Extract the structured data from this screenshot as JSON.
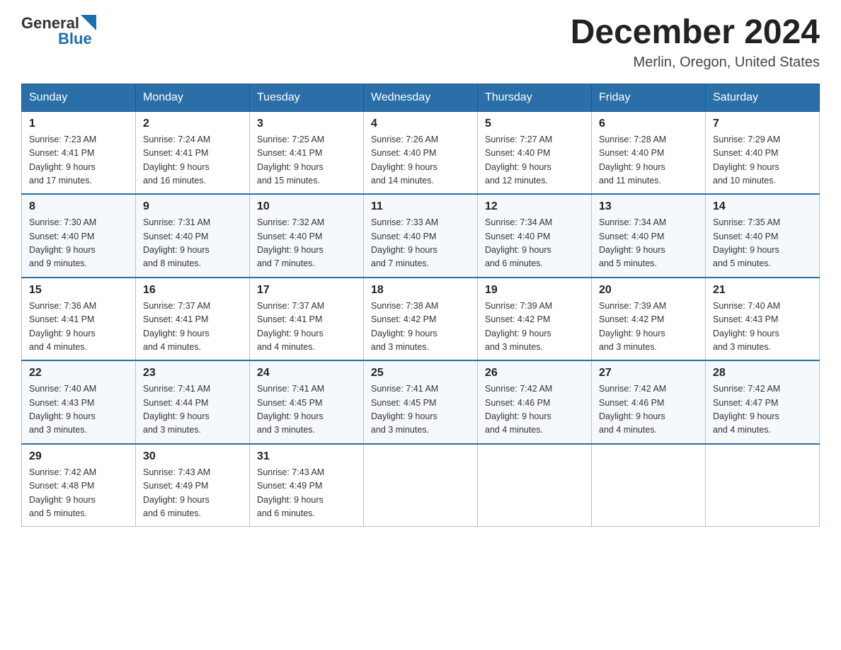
{
  "header": {
    "logo_general": "General",
    "logo_blue": "Blue",
    "month_title": "December 2024",
    "location": "Merlin, Oregon, United States"
  },
  "days_of_week": [
    "Sunday",
    "Monday",
    "Tuesday",
    "Wednesday",
    "Thursday",
    "Friday",
    "Saturday"
  ],
  "weeks": [
    [
      {
        "day": "1",
        "sunrise": "7:23 AM",
        "sunset": "4:41 PM",
        "daylight": "9 hours and 17 minutes."
      },
      {
        "day": "2",
        "sunrise": "7:24 AM",
        "sunset": "4:41 PM",
        "daylight": "9 hours and 16 minutes."
      },
      {
        "day": "3",
        "sunrise": "7:25 AM",
        "sunset": "4:41 PM",
        "daylight": "9 hours and 15 minutes."
      },
      {
        "day": "4",
        "sunrise": "7:26 AM",
        "sunset": "4:40 PM",
        "daylight": "9 hours and 14 minutes."
      },
      {
        "day": "5",
        "sunrise": "7:27 AM",
        "sunset": "4:40 PM",
        "daylight": "9 hours and 12 minutes."
      },
      {
        "day": "6",
        "sunrise": "7:28 AM",
        "sunset": "4:40 PM",
        "daylight": "9 hours and 11 minutes."
      },
      {
        "day": "7",
        "sunrise": "7:29 AM",
        "sunset": "4:40 PM",
        "daylight": "9 hours and 10 minutes."
      }
    ],
    [
      {
        "day": "8",
        "sunrise": "7:30 AM",
        "sunset": "4:40 PM",
        "daylight": "9 hours and 9 minutes."
      },
      {
        "day": "9",
        "sunrise": "7:31 AM",
        "sunset": "4:40 PM",
        "daylight": "9 hours and 8 minutes."
      },
      {
        "day": "10",
        "sunrise": "7:32 AM",
        "sunset": "4:40 PM",
        "daylight": "9 hours and 7 minutes."
      },
      {
        "day": "11",
        "sunrise": "7:33 AM",
        "sunset": "4:40 PM",
        "daylight": "9 hours and 7 minutes."
      },
      {
        "day": "12",
        "sunrise": "7:34 AM",
        "sunset": "4:40 PM",
        "daylight": "9 hours and 6 minutes."
      },
      {
        "day": "13",
        "sunrise": "7:34 AM",
        "sunset": "4:40 PM",
        "daylight": "9 hours and 5 minutes."
      },
      {
        "day": "14",
        "sunrise": "7:35 AM",
        "sunset": "4:40 PM",
        "daylight": "9 hours and 5 minutes."
      }
    ],
    [
      {
        "day": "15",
        "sunrise": "7:36 AM",
        "sunset": "4:41 PM",
        "daylight": "9 hours and 4 minutes."
      },
      {
        "day": "16",
        "sunrise": "7:37 AM",
        "sunset": "4:41 PM",
        "daylight": "9 hours and 4 minutes."
      },
      {
        "day": "17",
        "sunrise": "7:37 AM",
        "sunset": "4:41 PM",
        "daylight": "9 hours and 4 minutes."
      },
      {
        "day": "18",
        "sunrise": "7:38 AM",
        "sunset": "4:42 PM",
        "daylight": "9 hours and 3 minutes."
      },
      {
        "day": "19",
        "sunrise": "7:39 AM",
        "sunset": "4:42 PM",
        "daylight": "9 hours and 3 minutes."
      },
      {
        "day": "20",
        "sunrise": "7:39 AM",
        "sunset": "4:42 PM",
        "daylight": "9 hours and 3 minutes."
      },
      {
        "day": "21",
        "sunrise": "7:40 AM",
        "sunset": "4:43 PM",
        "daylight": "9 hours and 3 minutes."
      }
    ],
    [
      {
        "day": "22",
        "sunrise": "7:40 AM",
        "sunset": "4:43 PM",
        "daylight": "9 hours and 3 minutes."
      },
      {
        "day": "23",
        "sunrise": "7:41 AM",
        "sunset": "4:44 PM",
        "daylight": "9 hours and 3 minutes."
      },
      {
        "day": "24",
        "sunrise": "7:41 AM",
        "sunset": "4:45 PM",
        "daylight": "9 hours and 3 minutes."
      },
      {
        "day": "25",
        "sunrise": "7:41 AM",
        "sunset": "4:45 PM",
        "daylight": "9 hours and 3 minutes."
      },
      {
        "day": "26",
        "sunrise": "7:42 AM",
        "sunset": "4:46 PM",
        "daylight": "9 hours and 4 minutes."
      },
      {
        "day": "27",
        "sunrise": "7:42 AM",
        "sunset": "4:46 PM",
        "daylight": "9 hours and 4 minutes."
      },
      {
        "day": "28",
        "sunrise": "7:42 AM",
        "sunset": "4:47 PM",
        "daylight": "9 hours and 4 minutes."
      }
    ],
    [
      {
        "day": "29",
        "sunrise": "7:42 AM",
        "sunset": "4:48 PM",
        "daylight": "9 hours and 5 minutes."
      },
      {
        "day": "30",
        "sunrise": "7:43 AM",
        "sunset": "4:49 PM",
        "daylight": "9 hours and 6 minutes."
      },
      {
        "day": "31",
        "sunrise": "7:43 AM",
        "sunset": "4:49 PM",
        "daylight": "9 hours and 6 minutes."
      },
      null,
      null,
      null,
      null
    ]
  ],
  "labels": {
    "sunrise": "Sunrise:",
    "sunset": "Sunset:",
    "daylight": "Daylight:"
  }
}
